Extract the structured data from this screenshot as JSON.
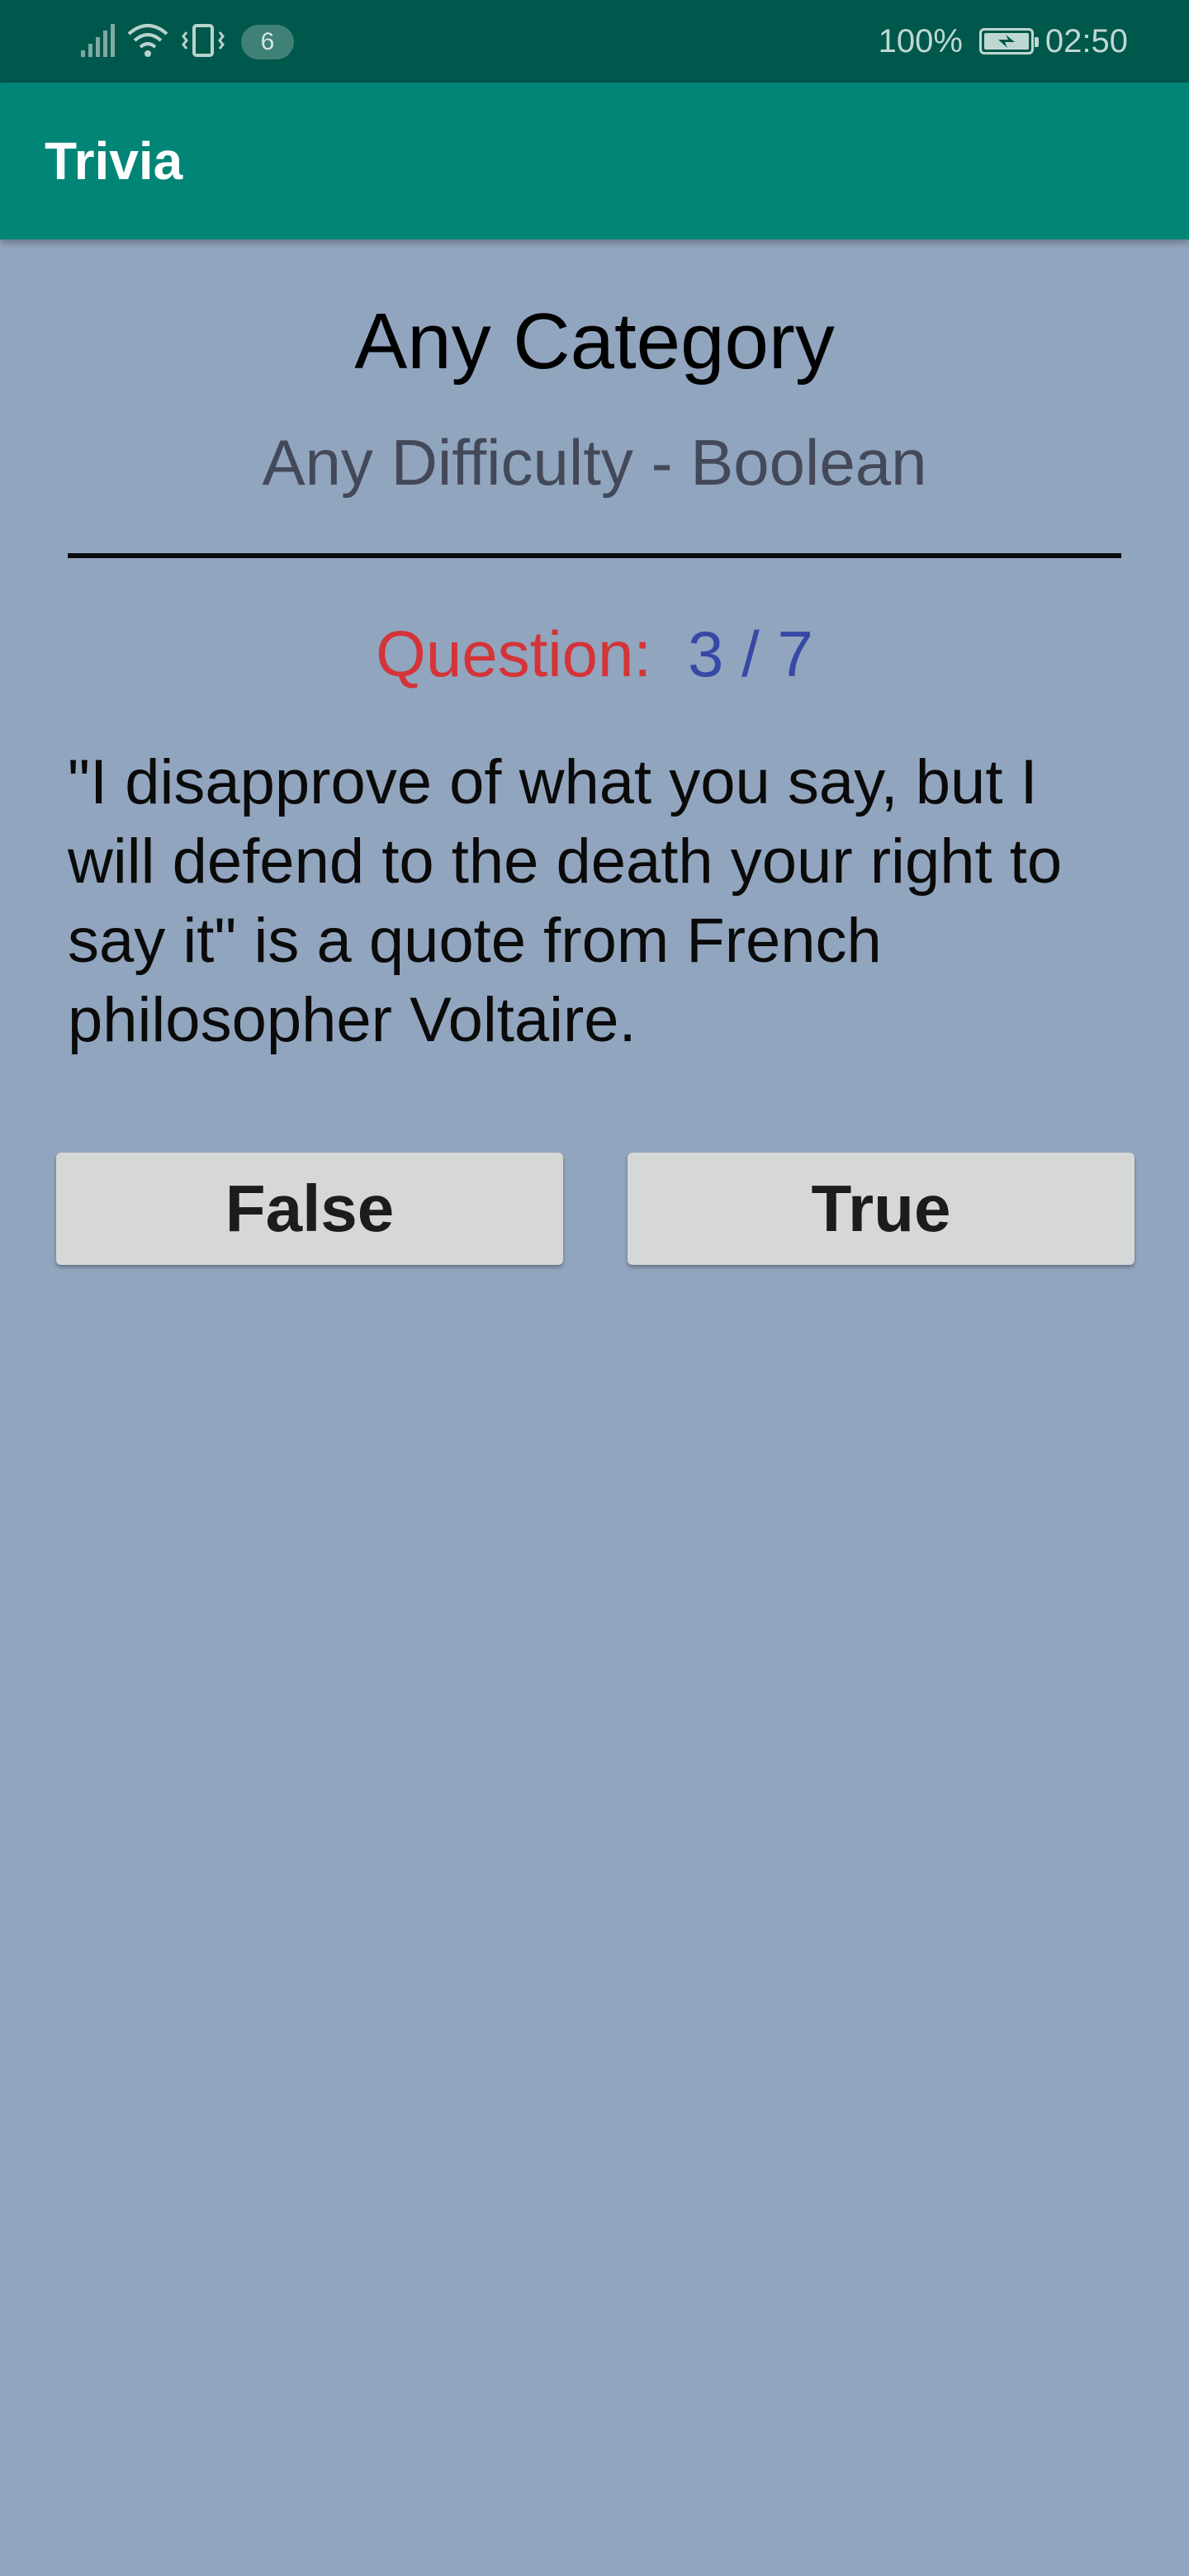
{
  "status_bar": {
    "notification_count": "6",
    "battery_percent": "100%",
    "time": "02:50",
    "icons": [
      "signal-icon",
      "wifi-icon",
      "vibrate-icon",
      "battery-charging-icon"
    ]
  },
  "app_bar": {
    "title": "Trivia"
  },
  "quiz": {
    "category": "Any Category",
    "difficulty": "Any Difficulty - Boolean",
    "question_label": "Question:",
    "question_count": "3 / 7",
    "question_text": "\"I disapprove of what you say, but I will defend to the death your right to say it\" is a quote from French philosopher Voltaire.",
    "answers": [
      {
        "label": "False"
      },
      {
        "label": "True"
      }
    ]
  },
  "colors": {
    "status_bar": "#00574b",
    "app_bar": "#008577",
    "background": "#91a5be",
    "question_label": "#d43438",
    "question_count": "#3848a6",
    "button": "#d6d7d7"
  }
}
